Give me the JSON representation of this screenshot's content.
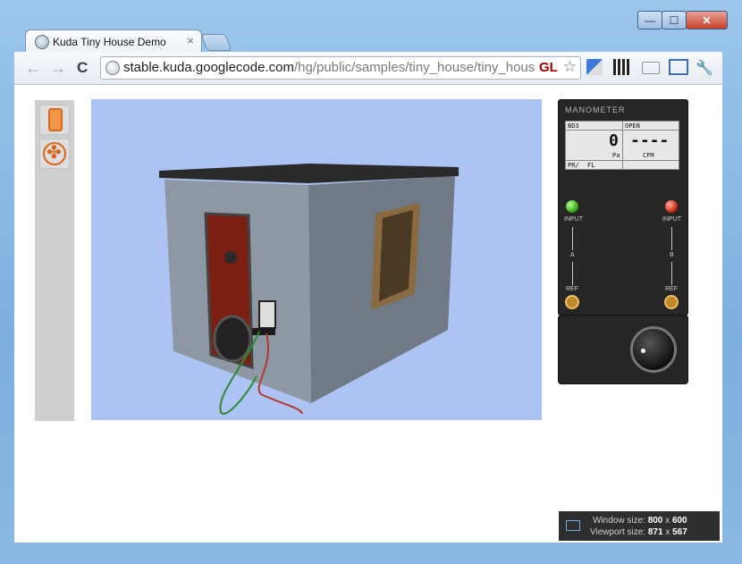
{
  "browser": {
    "tab_title": "Kuda Tiny House Demo",
    "tab_close": "×",
    "url_domain": "stable.kuda.googlecode.com",
    "url_rest": "/hg/public/samples/tiny_house/tiny_hous",
    "gl_badge": "GL",
    "back": "←",
    "forward": "→",
    "reload": "C",
    "star": "☆",
    "wrench": "🔧",
    "min": "—",
    "max": "☐",
    "close": "✕"
  },
  "manometer": {
    "title": "MANOMETER",
    "bd3": "BD3",
    "open": "OPEN",
    "value_a": "0",
    "value_b": "----",
    "unit_a": "Pa",
    "unit_b": "CFM",
    "pr": "PR/",
    "fl": "FL",
    "input_a": "INPUT",
    "input_b": "INPUT",
    "label_a": "A",
    "label_b": "B",
    "ref_a": "REF",
    "ref_b": "REF"
  },
  "window_size": {
    "label1": "Window size:",
    "value1_w": "800",
    "value1_x": "x",
    "value1_h": "600",
    "label2": "Viewport size:",
    "value2_w": "871",
    "value2_x": "x",
    "value2_h": "567"
  }
}
